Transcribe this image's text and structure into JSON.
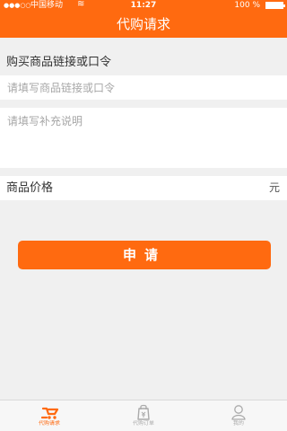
{
  "status_bar": {
    "signal": "●●●○○",
    "carrier": "中国移动",
    "wifi_icon": "wifi-icon",
    "time": "11:27",
    "battery": "100 %"
  },
  "header": {
    "title": "代购请求"
  },
  "form": {
    "link_section_label": "购买商品链接或口令",
    "link_placeholder": "请填写商品链接或口令",
    "note_placeholder": "请填写补充说明",
    "price_label": "商品价格",
    "price_unit": "元",
    "submit_label": "申请"
  },
  "tabs": [
    {
      "label": "代购请求",
      "icon": "cart-icon",
      "selected": true
    },
    {
      "label": "代购订单",
      "icon": "order-bag-icon",
      "selected": false
    },
    {
      "label": "我的",
      "icon": "user-icon",
      "selected": false
    }
  ],
  "colors": {
    "accent": "#ff6a10",
    "background": "#f0f0f0",
    "placeholder": "#a7a7a7",
    "inactive_tab": "#aaaaaa"
  }
}
